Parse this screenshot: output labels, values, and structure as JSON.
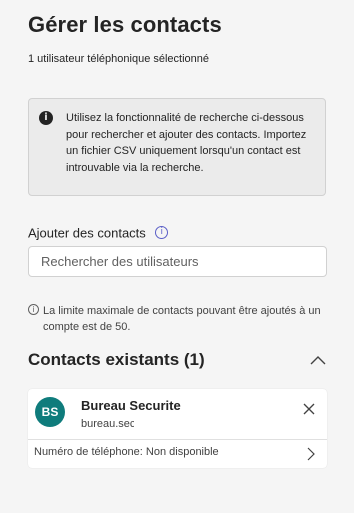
{
  "header": {
    "title": "Gérer les contacts",
    "subtitle": "1 utilisateur téléphonique sélectionné"
  },
  "info_banner": {
    "icon": "info-icon",
    "text": "Utilisez la fonctionnalité de recherche ci-dessous pour rechercher et ajouter des contacts. Importez un fichier CSV uniquement lorsqu'un contact est introuvable via la recherche."
  },
  "add_contacts": {
    "label": "Ajouter des contacts",
    "search_placeholder": "Rechercher des utilisateurs",
    "search_value": ""
  },
  "limit_note": {
    "text": "La limite maximale de contacts pouvant être ajoutés à un compte est de 50."
  },
  "existing_contacts": {
    "title": "Contacts existants (1)",
    "items": [
      {
        "initials": "BS",
        "name": "Bureau Securite",
        "email_visible": "bureau.sec",
        "phone_line": "Numéro de téléphone: Non disponible"
      }
    ]
  },
  "colors": {
    "background": "#f5f5f5",
    "info_box": "#ebebeb",
    "avatar": "#0f7c7c",
    "accent": "#5b5fc7"
  }
}
